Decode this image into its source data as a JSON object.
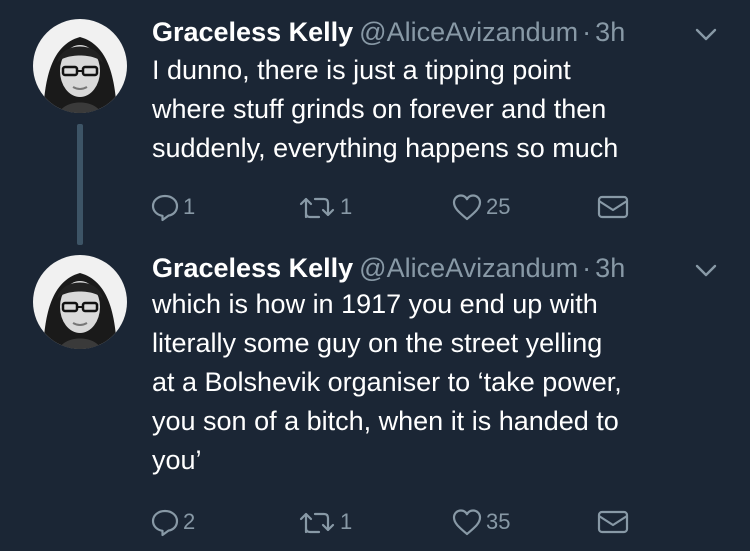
{
  "tweets": [
    {
      "name": "Graceless Kelly",
      "handle": "@AliceAvizandum",
      "separator": "·",
      "time": "3h",
      "lines": [
        "I dunno, there is just a tipping point",
        "where stuff grinds on forever and then",
        "suddenly, everything happens so much"
      ],
      "replies": "1",
      "retweets": "1",
      "likes": "25"
    },
    {
      "name": "Graceless Kelly",
      "handle": "@AliceAvizandum",
      "separator": "·",
      "time": "3h",
      "lines": [
        "which is how in 1917 you end up with",
        "literally some guy on the street yelling",
        "at a Bolshevik organiser to ‘take power,",
        "you son of a bitch, when it is handed to",
        "you’"
      ],
      "replies": "2",
      "retweets": "1",
      "likes": "35"
    }
  ],
  "icons": {
    "reply": "reply-icon",
    "retweet": "retweet-icon",
    "like": "heart-icon",
    "message": "envelope-icon",
    "more": "chevron-down-icon"
  },
  "colors": {
    "background": "#1b2635",
    "secondary_text": "#8899a6",
    "thread_line": "#3d5466"
  }
}
